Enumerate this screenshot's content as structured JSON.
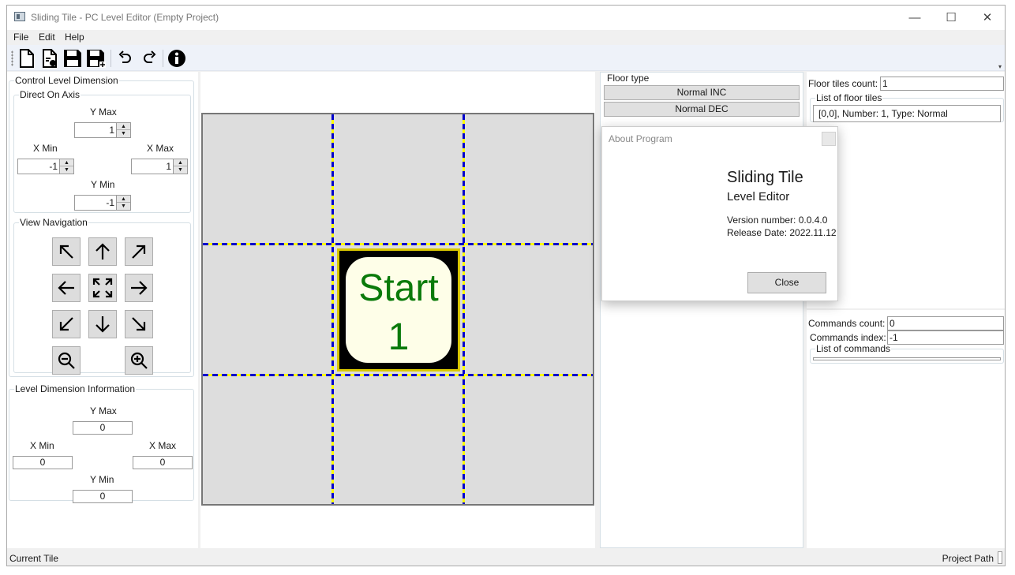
{
  "window": {
    "title": "Sliding Tile - PC Level Editor (Empty Project)",
    "minimize_glyph": "—",
    "maximize_glyph": "☐",
    "close_glyph": "✕"
  },
  "menu": [
    "File",
    "Edit",
    "Help"
  ],
  "toolbar": {
    "icons": [
      "new-file-icon",
      "open-file-icon",
      "save-icon",
      "save-as-icon",
      "undo-icon",
      "redo-icon",
      "info-icon"
    ],
    "overflow_glyph": "▾"
  },
  "control_level_dimension": {
    "title": "Control Level Dimension",
    "direct_on_axis": {
      "title": "Direct On Axis",
      "y_max_label": "Y Max",
      "y_max": "1",
      "x_min_label": "X Min",
      "x_min": "-1",
      "x_max_label": "X Max",
      "x_max": "1",
      "y_min_label": "Y Min",
      "y_min": "-1"
    },
    "view_navigation": {
      "title": "View Navigation",
      "buttons": [
        "arrow-up-left-icon",
        "arrow-up-icon",
        "arrow-up-right-icon",
        "arrow-left-icon",
        "fit-view-icon",
        "arrow-right-icon",
        "arrow-down-left-icon",
        "arrow-down-icon",
        "arrow-down-right-icon",
        "zoom-out-icon",
        "zoom-in-icon"
      ]
    }
  },
  "level_dimension_information": {
    "title": "Level Dimension Information",
    "y_max_label": "Y Max",
    "y_max": "0",
    "x_min_label": "X Min",
    "x_min": "0",
    "x_max_label": "X Max",
    "x_max": "0",
    "y_min_label": "Y Min",
    "y_min": "0"
  },
  "canvas": {
    "start_label": "Start",
    "start_number": "1",
    "colors": {
      "grid_dash_blue": "#0000cc",
      "grid_dash_yellow": "#ffff00",
      "start_text": "#0a7a0a",
      "tile_bg": "#dddddd"
    }
  },
  "floor_type": {
    "title": "Floor type",
    "buttons": [
      "Normal INC",
      "Normal DEC"
    ]
  },
  "floor_tiles": {
    "count_label": "Floor tiles count:",
    "count": "1",
    "list_title": "List of floor tiles",
    "items": [
      "[0,0], Number: 1, Type: Normal"
    ]
  },
  "commands": {
    "count_label": "Commands count:",
    "count": "0",
    "index_label": "Commands index:",
    "index": "-1",
    "list_title": "List of commands"
  },
  "statusbar": {
    "current_tile": "Current Tile",
    "project_path": "Project Path"
  },
  "about_dialog": {
    "title": "About Program",
    "app_name": "Sliding Tile",
    "subtitle": "Level Editor",
    "version": "Version number: 0.0.4.0",
    "release_date": "Release Date: 2022.11.12",
    "close_label": "Close"
  }
}
